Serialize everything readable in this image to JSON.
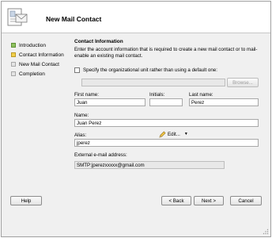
{
  "header": {
    "title": "New Mail Contact"
  },
  "nav": {
    "items": [
      {
        "label": "Introduction",
        "state": "done"
      },
      {
        "label": "Contact Information",
        "state": "current"
      },
      {
        "label": "New Mail Contact",
        "state": "pending"
      },
      {
        "label": "Completion",
        "state": "pending"
      }
    ]
  },
  "main": {
    "section_title": "Contact Information",
    "description": "Enter the account information that is required to create a new mail contact or to mail-enable an existing mail contact.",
    "ou_checkbox_label": "Specify the organizational unit rather than using a default one:",
    "ou_value": "",
    "browse_label": "Browse...",
    "first_name_label": "First name:",
    "first_name_value": "Juan",
    "initials_label": "Initials:",
    "initials_value": "",
    "last_name_label": "Last name:",
    "last_name_value": "Perez",
    "name_label": "Name:",
    "name_value": "Juan Perez",
    "alias_label": "Alias:",
    "alias_value": "jperez",
    "external_email_label": "External e-mail address:",
    "external_email_value": "SMTP:jperezxxxxx@gmail.com",
    "edit_label": "Edit...",
    "edit_caret": "▼"
  },
  "footer": {
    "help_label": "Help",
    "back_label": "< Back",
    "next_label": "Next >",
    "cancel_label": "Cancel"
  },
  "colors": {
    "done": "#8fc25f",
    "current": "#f2d04a",
    "pending": "#e4e4e4"
  }
}
